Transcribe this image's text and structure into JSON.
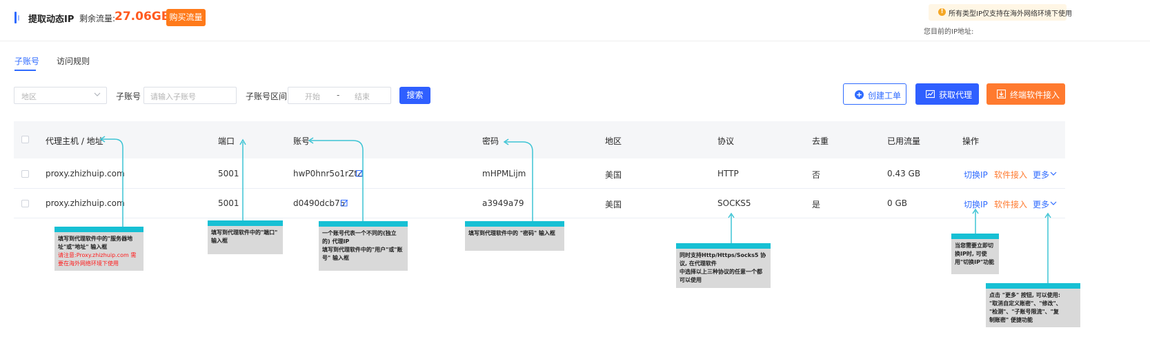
{
  "header": {
    "title": "提取动态IP",
    "traffic_label": "剩余流量:",
    "traffic_value": "27.06GB",
    "buy_label": "购买流量",
    "notice": "所有类型IP仅支持在海外网络环境下使用",
    "ip_label": "您目前的IP地址:"
  },
  "tabs": [
    {
      "label": "子账号",
      "active": true
    },
    {
      "label": "访问规则",
      "active": false
    }
  ],
  "filters": {
    "region_placeholder": "地区",
    "sub_label": "子账号",
    "sub_placeholder": "请输入子账号",
    "range_label": "子账号区间",
    "range_start": "开始",
    "range_sep": "-",
    "range_end": "结束",
    "search_label": "搜索"
  },
  "actions": {
    "create_ticket": "创建工单",
    "get_proxy": "获取代理",
    "terminal_access": "终端软件接入"
  },
  "table": {
    "headers": [
      "代理主机 / 地址",
      "端口",
      "账号",
      "密码",
      "地区",
      "协议",
      "去重",
      "已用流量",
      "操作"
    ],
    "rows": [
      {
        "host": "proxy.zhizhuip.com",
        "port": "5001",
        "account": "hwP0hnr5o1rZtZ",
        "password": "mHPMLijm",
        "region": "美国",
        "protocol": "HTTP",
        "dedup": "否",
        "used": "0.43 GB"
      },
      {
        "host": "proxy.zhizhuip.com",
        "port": "5001",
        "account": "d0490dcb75",
        "password": "a3949a79",
        "region": "美国",
        "protocol": "SOCKS5",
        "dedup": "是",
        "used": "0 GB"
      }
    ],
    "ops": {
      "switch_ip": "切换IP",
      "software_access": "软件接入",
      "more": "更多"
    }
  },
  "annotations": {
    "host": {
      "line1": "填写到代理软件中的\"服务器地",
      "line2": "址\"或\"地址\" 输入框",
      "warn1": "请注意:Proxy.zhizhuip.com 需",
      "warn2": "要在海外网络环境下使用"
    },
    "port": {
      "line1": "填写到代理软件中的\"端口\"",
      "line2": "输入框"
    },
    "account": {
      "line1": "一个账号代表一个不同的(独立",
      "line2": "的) 代理IP",
      "line3": "填写到代理软件中的\"用户\"或\"账",
      "line4": "号\" 输入框"
    },
    "password": {
      "line1": "填写到代理软件中的 \"密码\" 输入框"
    },
    "protocol": {
      "line1": "同时支持Http/Https/Socks5 协",
      "line2": "议, 在代理软件",
      "line3": "中选择以上三种协议的任意一个都",
      "line4": "可以使用"
    },
    "switch": {
      "line1": "当您需要立即切",
      "line2": "换IP时, 可使",
      "line3": "用\"切换IP\"功能"
    },
    "more": {
      "line1": "点击 \"更多\" 按钮, 可以使用:",
      "line2": "\"取消自定义账密\"、\"修改\"、",
      "line3": "\"检测\"、\"子账号限流\"、\"复",
      "line4": "制账密\" 便捷功能"
    }
  },
  "colors": {
    "accent": "#2f6bff",
    "orange": "#ff7a2f",
    "annotation": "#17c0d4"
  }
}
